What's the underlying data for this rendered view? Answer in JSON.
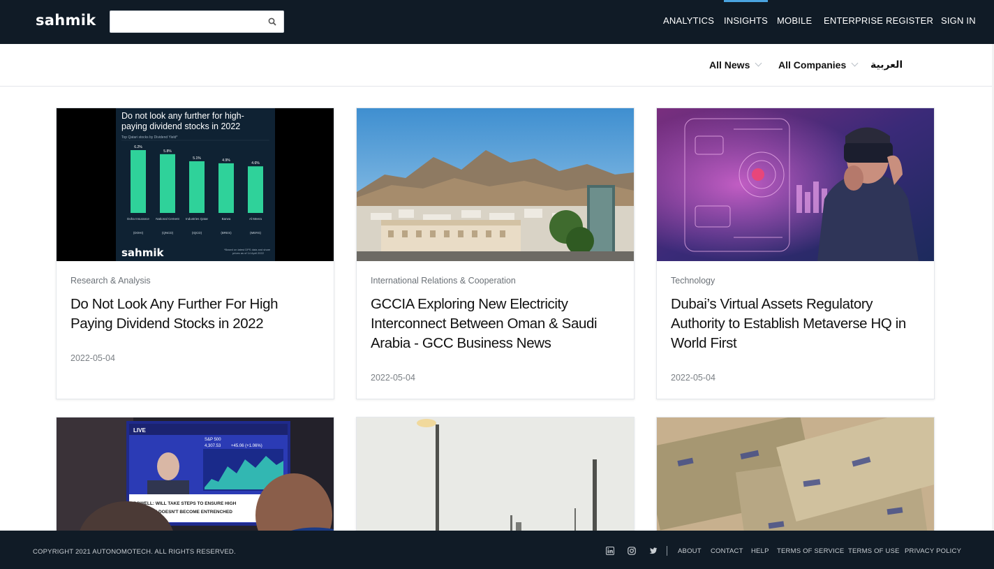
{
  "header": {
    "logo": "sahmik",
    "search": {
      "placeholder": "",
      "value": ""
    },
    "nav": [
      {
        "label": "ANALYTICS"
      },
      {
        "label": "INSIGHTS",
        "active": true
      },
      {
        "label": "MOBILE"
      },
      {
        "label": "ENTERPRISE"
      },
      {
        "label": "REGISTER"
      },
      {
        "label": "SIGN IN"
      }
    ]
  },
  "filters": {
    "news": "All News",
    "companies": "All Companies",
    "language": "العربية"
  },
  "articles": [
    {
      "category": "Research & Analysis",
      "title": "Do Not Look Any Further For High Paying Dividend Stocks in 2022",
      "date": "2022-05-04",
      "image": {
        "heading": "Do not look any further for high-paying dividend stocks in 2022",
        "subheading": "Top Qatari stocks by Dividend Yield*",
        "bars": [
          {
            "value_label": "6.2%",
            "value": 6.2,
            "name": "Doha Insurance",
            "ticker": "(DOHI)"
          },
          {
            "value_label": "5.8%",
            "value": 5.8,
            "name": "National Cement",
            "ticker": "(QNCD)"
          },
          {
            "value_label": "5.1%",
            "value": 5.1,
            "name": "Industries Qatar",
            "ticker": "(IQCD)"
          },
          {
            "value_label": "4.9%",
            "value": 4.9,
            "name": "Barwa",
            "ticker": "(BRES)"
          },
          {
            "value_label": "4.6%",
            "value": 4.6,
            "name": "Al Meera",
            "ticker": "(MERS)"
          }
        ],
        "brand": "sahmik",
        "footnote": "*Based on latest DPS data and share prices as of 14 April 2022"
      }
    },
    {
      "category": "International Relations & Cooperation",
      "title": "GCCIA Exploring New Electricity Interconnect Between Oman & Saudi Arabia - GCC Business News",
      "date": "2022-05-04"
    },
    {
      "category": "Technology",
      "title": "Dubai’s Virtual Assets Regulatory Authority to Establish Metaverse HQ in World First",
      "date": "2022-05-04"
    },
    {
      "image": {
        "ticker_text": "POWELL: WILL TAKE STEPS TO ENSURE HIGH INFLATION DOESN'T BECOME ENTRENCHED",
        "badge": "LIVE",
        "index": "S&P 500",
        "index_value": "4,307.53",
        "index_change": "+45.06 (+1.06%)"
      }
    },
    {},
    {}
  ],
  "footer": {
    "copyright": "COPYRIGHT 2021 AUTONOMOTECH. ALL RIGHTS RESERVED.",
    "links": [
      "ABOUT",
      "CONTACT",
      "HELP",
      "TERMS OF SERVICE",
      "TERMS OF USE",
      "PRIVACY POLICY"
    ],
    "social": [
      "linkedin-icon",
      "instagram-icon",
      "twitter-icon"
    ]
  },
  "colors": {
    "navbar": "#101b26",
    "accent": "#4aa3df",
    "chart_bar": "#2fd29a",
    "chart_bg": "#0f2233"
  }
}
